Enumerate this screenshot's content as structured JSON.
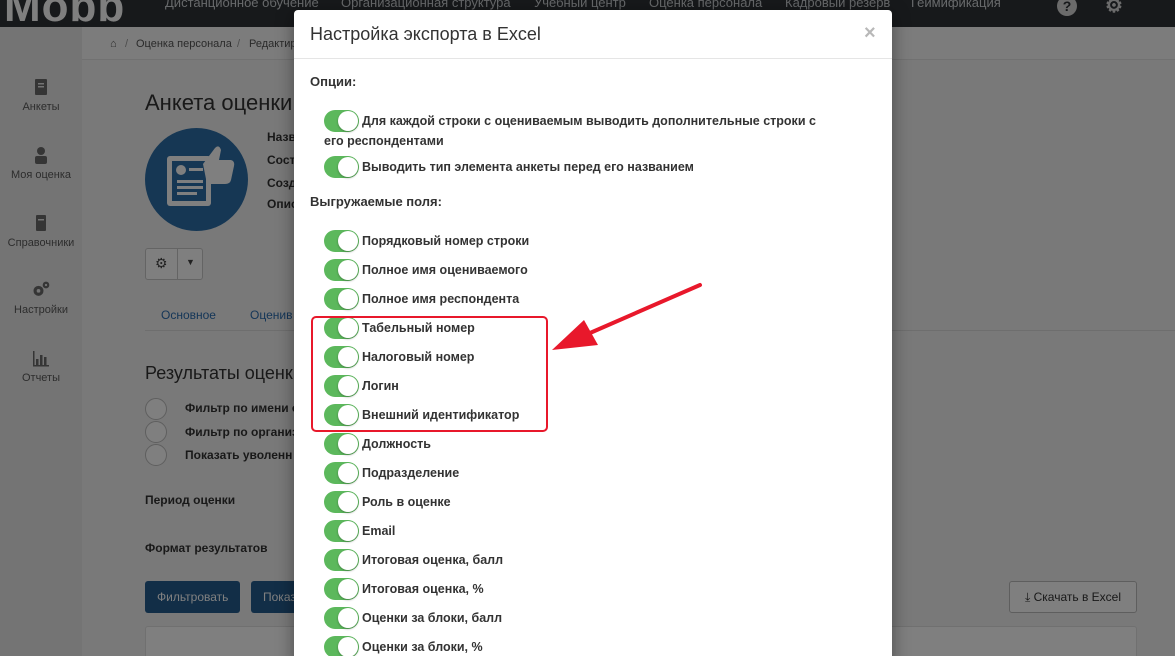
{
  "topbar": {
    "logo": "Mobb",
    "nav": [
      "Дистанционное обучение",
      "Организационная структура",
      "Учебный центр",
      "Оценка персонала",
      "Кадровый резерв",
      "Геймификация"
    ],
    "help_icon": "question-icon",
    "settings_icon": "gear-icon"
  },
  "sidebar": {
    "items": [
      {
        "label": "Анкеты",
        "icon": "clipboard-icon"
      },
      {
        "label": "Моя оценка",
        "icon": "user-badge-icon"
      },
      {
        "label": "Справочники",
        "icon": "book-icon"
      },
      {
        "label": "Настройки",
        "icon": "gears-icon"
      },
      {
        "label": "Отчеты",
        "icon": "chart-icon"
      }
    ]
  },
  "breadcrumb": {
    "home_icon": "home-icon",
    "items": [
      "Оценка персонала",
      "Редактир"
    ]
  },
  "page": {
    "title": "Анкета оценки",
    "meta_labels": [
      "Назв",
      "Сост",
      "Созд",
      "Опис"
    ],
    "tabs": [
      "Основное",
      "Оценив"
    ],
    "section_title": "Результаты оценки",
    "filters": [
      "Фильтр по имени о",
      "Фильтр по организ",
      "Показать уволенн"
    ],
    "period_label": "Период оценки",
    "format_label": "Формат результатов",
    "filter_button": "Фильтровать",
    "show_button": "Показ",
    "download_button": "Скачать в Excel"
  },
  "modal": {
    "title": "Настройка экспорта в Excel",
    "close": "×",
    "options_title": "Опции:",
    "options": [
      {
        "label": "Для каждой строки с оцениваемым выводить дополнительные строки с его респондентами",
        "on": true
      },
      {
        "label": "Выводить тип элемента анкеты перед его названием",
        "on": true
      }
    ],
    "fields_title": "Выгружаемые поля:",
    "fields": [
      {
        "label": "Порядковый номер строки",
        "on": true
      },
      {
        "label": "Полное имя оцениваемого",
        "on": true
      },
      {
        "label": "Полное имя респондента",
        "on": true
      },
      {
        "label": "Табельный номер",
        "on": true
      },
      {
        "label": "Налоговый номер",
        "on": true
      },
      {
        "label": "Логин",
        "on": true
      },
      {
        "label": "Внешний идентификатор",
        "on": true
      },
      {
        "label": "Должность",
        "on": true
      },
      {
        "label": "Подразделение",
        "on": true
      },
      {
        "label": "Роль в оценке",
        "on": true
      },
      {
        "label": "Email",
        "on": true
      },
      {
        "label": "Итоговая оценка, балл",
        "on": true
      },
      {
        "label": "Итоговая оценка, %",
        "on": true
      },
      {
        "label": "Оценки за блоки, балл",
        "on": true
      },
      {
        "label": "Оценки за блоки, %",
        "on": true
      }
    ]
  },
  "colors": {
    "toggle_on": "#5cb85c",
    "primary": "#255d8f",
    "annotation": "#e8182b",
    "topbar": "#2f3236"
  }
}
